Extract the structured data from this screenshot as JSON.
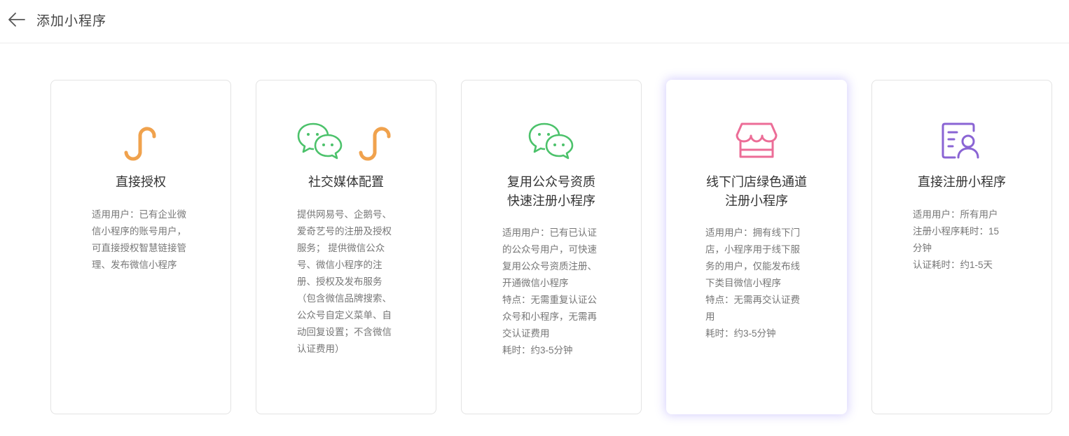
{
  "header": {
    "title": "添加小程序"
  },
  "cards": [
    {
      "title": "直接授权",
      "desc": "适用用户：已有企业微\n信小程序的账号用户，\n可直接授权智慧链接管\n理、发布微信小程序"
    },
    {
      "title": "社交媒体配置",
      "desc": "提供网易号、企鹅号、\n爱奇艺号的注册及授权\n服务； 提供微信公众\n号、微信小程序的注\n册、授权及发布服务\n（包含微信品牌搜索、\n公众号自定义菜单、自\n动回复设置；不含微信\n认证费用）"
    },
    {
      "title": "复用公众号资质\n快速注册小程序",
      "desc": "适用用户：已有已认证\n的公众号用户，可快速\n复用公众号资质注册、\n开通微信小程序\n特点：无需重复认证公\n众号和小程序，无需再\n交认证费用\n耗时：约3-5分钟"
    },
    {
      "title": "线下门店绿色通道\n注册小程序",
      "desc": "适用用户：拥有线下门\n店，小程序用于线下服\n务的用户，仅能发布线\n下类目微信小程序\n特点：无需再交认证费\n用\n耗时：约3-5分钟"
    },
    {
      "title": "直接注册小程序",
      "desc": "适用用户：所有用户\n注册小程序耗时：15\n分钟\n认证耗时：约1-5天"
    }
  ],
  "icons": {
    "orange": "#f0a24d",
    "green": "#4cc26b",
    "pink": "#ec6d97",
    "purple": "#8a64d4"
  }
}
